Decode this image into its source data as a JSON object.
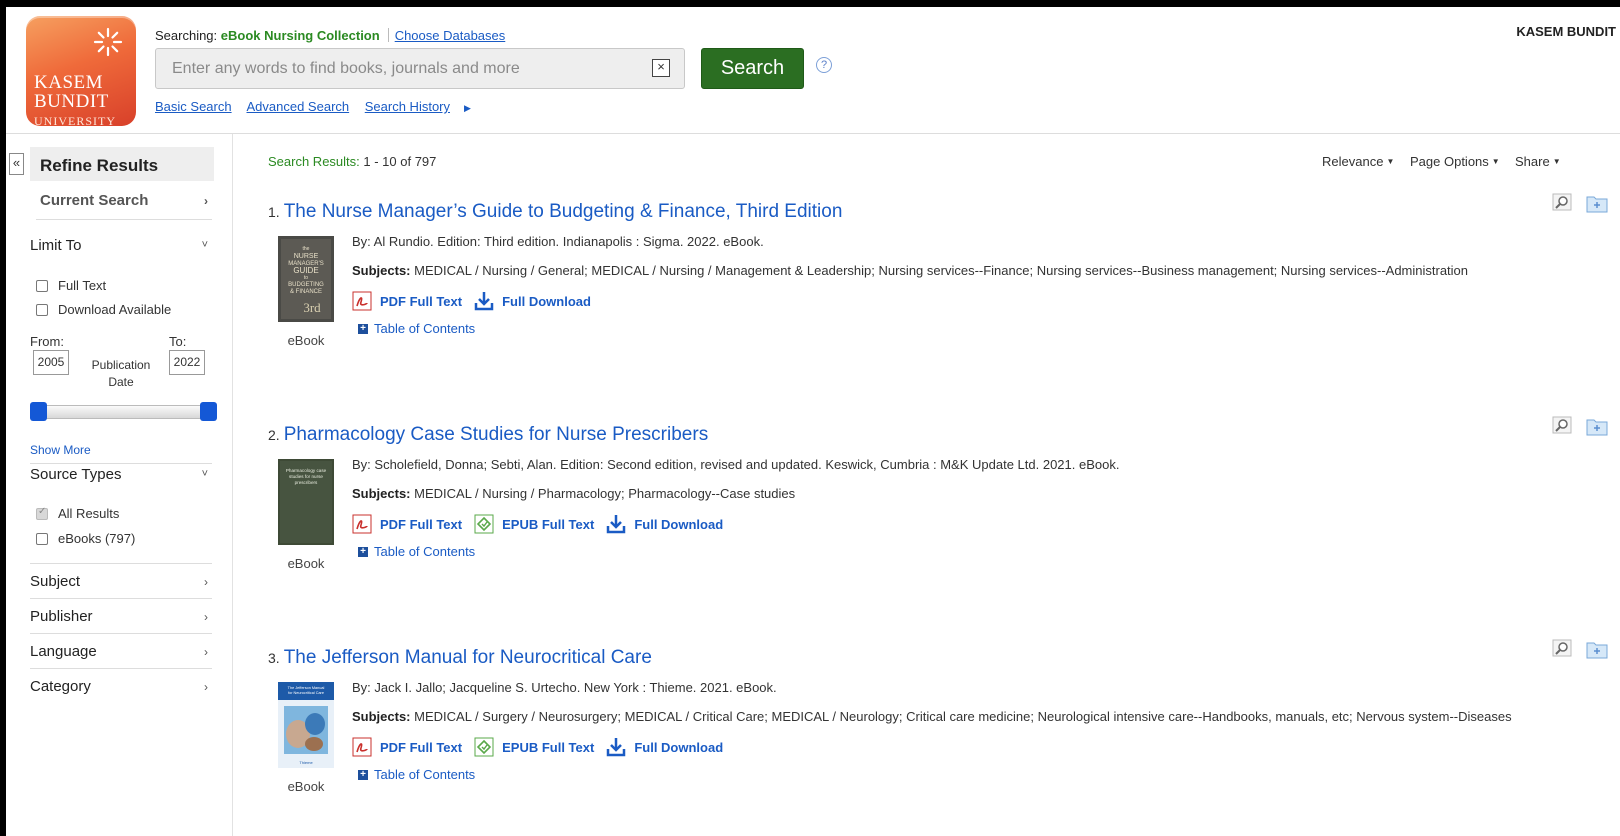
{
  "header": {
    "logo": {
      "line1": "KASEM",
      "line2": "BUNDIT",
      "line3": "UNIVERSITY"
    },
    "searching_label": "Searching:",
    "collection": "eBook Nursing Collection",
    "choose_databases": "Choose Databases",
    "search_placeholder": "Enter any words to find books, journals and more",
    "search_value": "",
    "clear_label": "×",
    "search_button": "Search",
    "help": "?",
    "links": [
      "Basic Search",
      "Advanced Search",
      "Search History"
    ],
    "user": "KASEM BUNDIT"
  },
  "sidebar": {
    "collapse": "«",
    "refine_title": "Refine Results",
    "current_search": "Current Search",
    "limit_to": "Limit To",
    "limit_options": [
      {
        "label": "Full Text",
        "checked": false
      },
      {
        "label": "Download Available",
        "checked": false
      }
    ],
    "from_label": "From:",
    "to_label": "To:",
    "from_year": "2005",
    "to_year": "2022",
    "date_label_1": "Publication",
    "date_label_2": "Date",
    "show_more": "Show More",
    "source_types": "Source Types",
    "source_options": [
      {
        "label": "All Results",
        "checked": true
      },
      {
        "label": "eBooks (797)",
        "checked": false
      }
    ],
    "facets": [
      "Subject",
      "Publisher",
      "Language",
      "Category"
    ]
  },
  "toolbar": {
    "results_label": "Search Results:",
    "results_range": "1 - 10 of 797",
    "relevance": "Relevance",
    "page_options": "Page Options",
    "share": "Share"
  },
  "results": [
    {
      "num": "1.",
      "title": "The Nurse Manager’s Guide to Budgeting & Finance, Third Edition",
      "byline": "By: Al Rundio. Edition: Third edition. Indianapolis : Sigma. 2022. eBook.",
      "subjects_label": "Subjects:",
      "subjects": "MEDICAL / Nursing / General; MEDICAL / Nursing / Management & Leadership; Nursing services--Finance; Nursing services--Business management; Nursing services--Administration",
      "pdf": "PDF Full Text",
      "download": "Full Download",
      "toc": "Table of Contents",
      "type": "eBook",
      "cover_text": [
        "the",
        "NURSE",
        "MANAGER'S",
        "GUIDE",
        "to",
        "BUDGETING",
        "& FINANCE",
        "3rd"
      ]
    },
    {
      "num": "2.",
      "title": "Pharmacology Case Studies for Nurse Prescribers",
      "byline": "By: Scholefield, Donna; Sebti, Alan. Edition: Second edition, revised and updated. Keswick, Cumbria : M&K Update Ltd. 2021. eBook.",
      "subjects_label": "Subjects:",
      "subjects": "MEDICAL / Nursing / Pharmacology; Pharmacology--Case studies",
      "pdf": "PDF Full Text",
      "epub": "EPUB Full Text",
      "download": "Full Download",
      "toc": "Table of Contents",
      "type": "eBook",
      "cover_text": [
        "Pharmacology case",
        "studies for nurse",
        "prescribers"
      ]
    },
    {
      "num": "3.",
      "title": "The Jefferson Manual for Neurocritical Care",
      "byline": "By: Jack I. Jallo; Jacqueline S. Urtecho. New York : Thieme. 2021. eBook.",
      "subjects_label": "Subjects:",
      "subjects": "MEDICAL / Surgery / Neurosurgery; MEDICAL / Critical Care; MEDICAL / Neurology; Critical care medicine; Neurological intensive care--Handbooks, manuals, etc; Nervous system--Diseases",
      "pdf": "PDF Full Text",
      "epub": "EPUB Full Text",
      "download": "Full Download",
      "toc": "Table of Contents",
      "type": "eBook",
      "cover_text": [
        "The Jefferson Manual",
        "for Neurocritical Care",
        "Thieme"
      ]
    }
  ],
  "colors": {
    "link": "#1a5bc4",
    "search_button": "#2b6e22",
    "collection": "#2b8a22",
    "slider_handle": "#1458d6"
  }
}
